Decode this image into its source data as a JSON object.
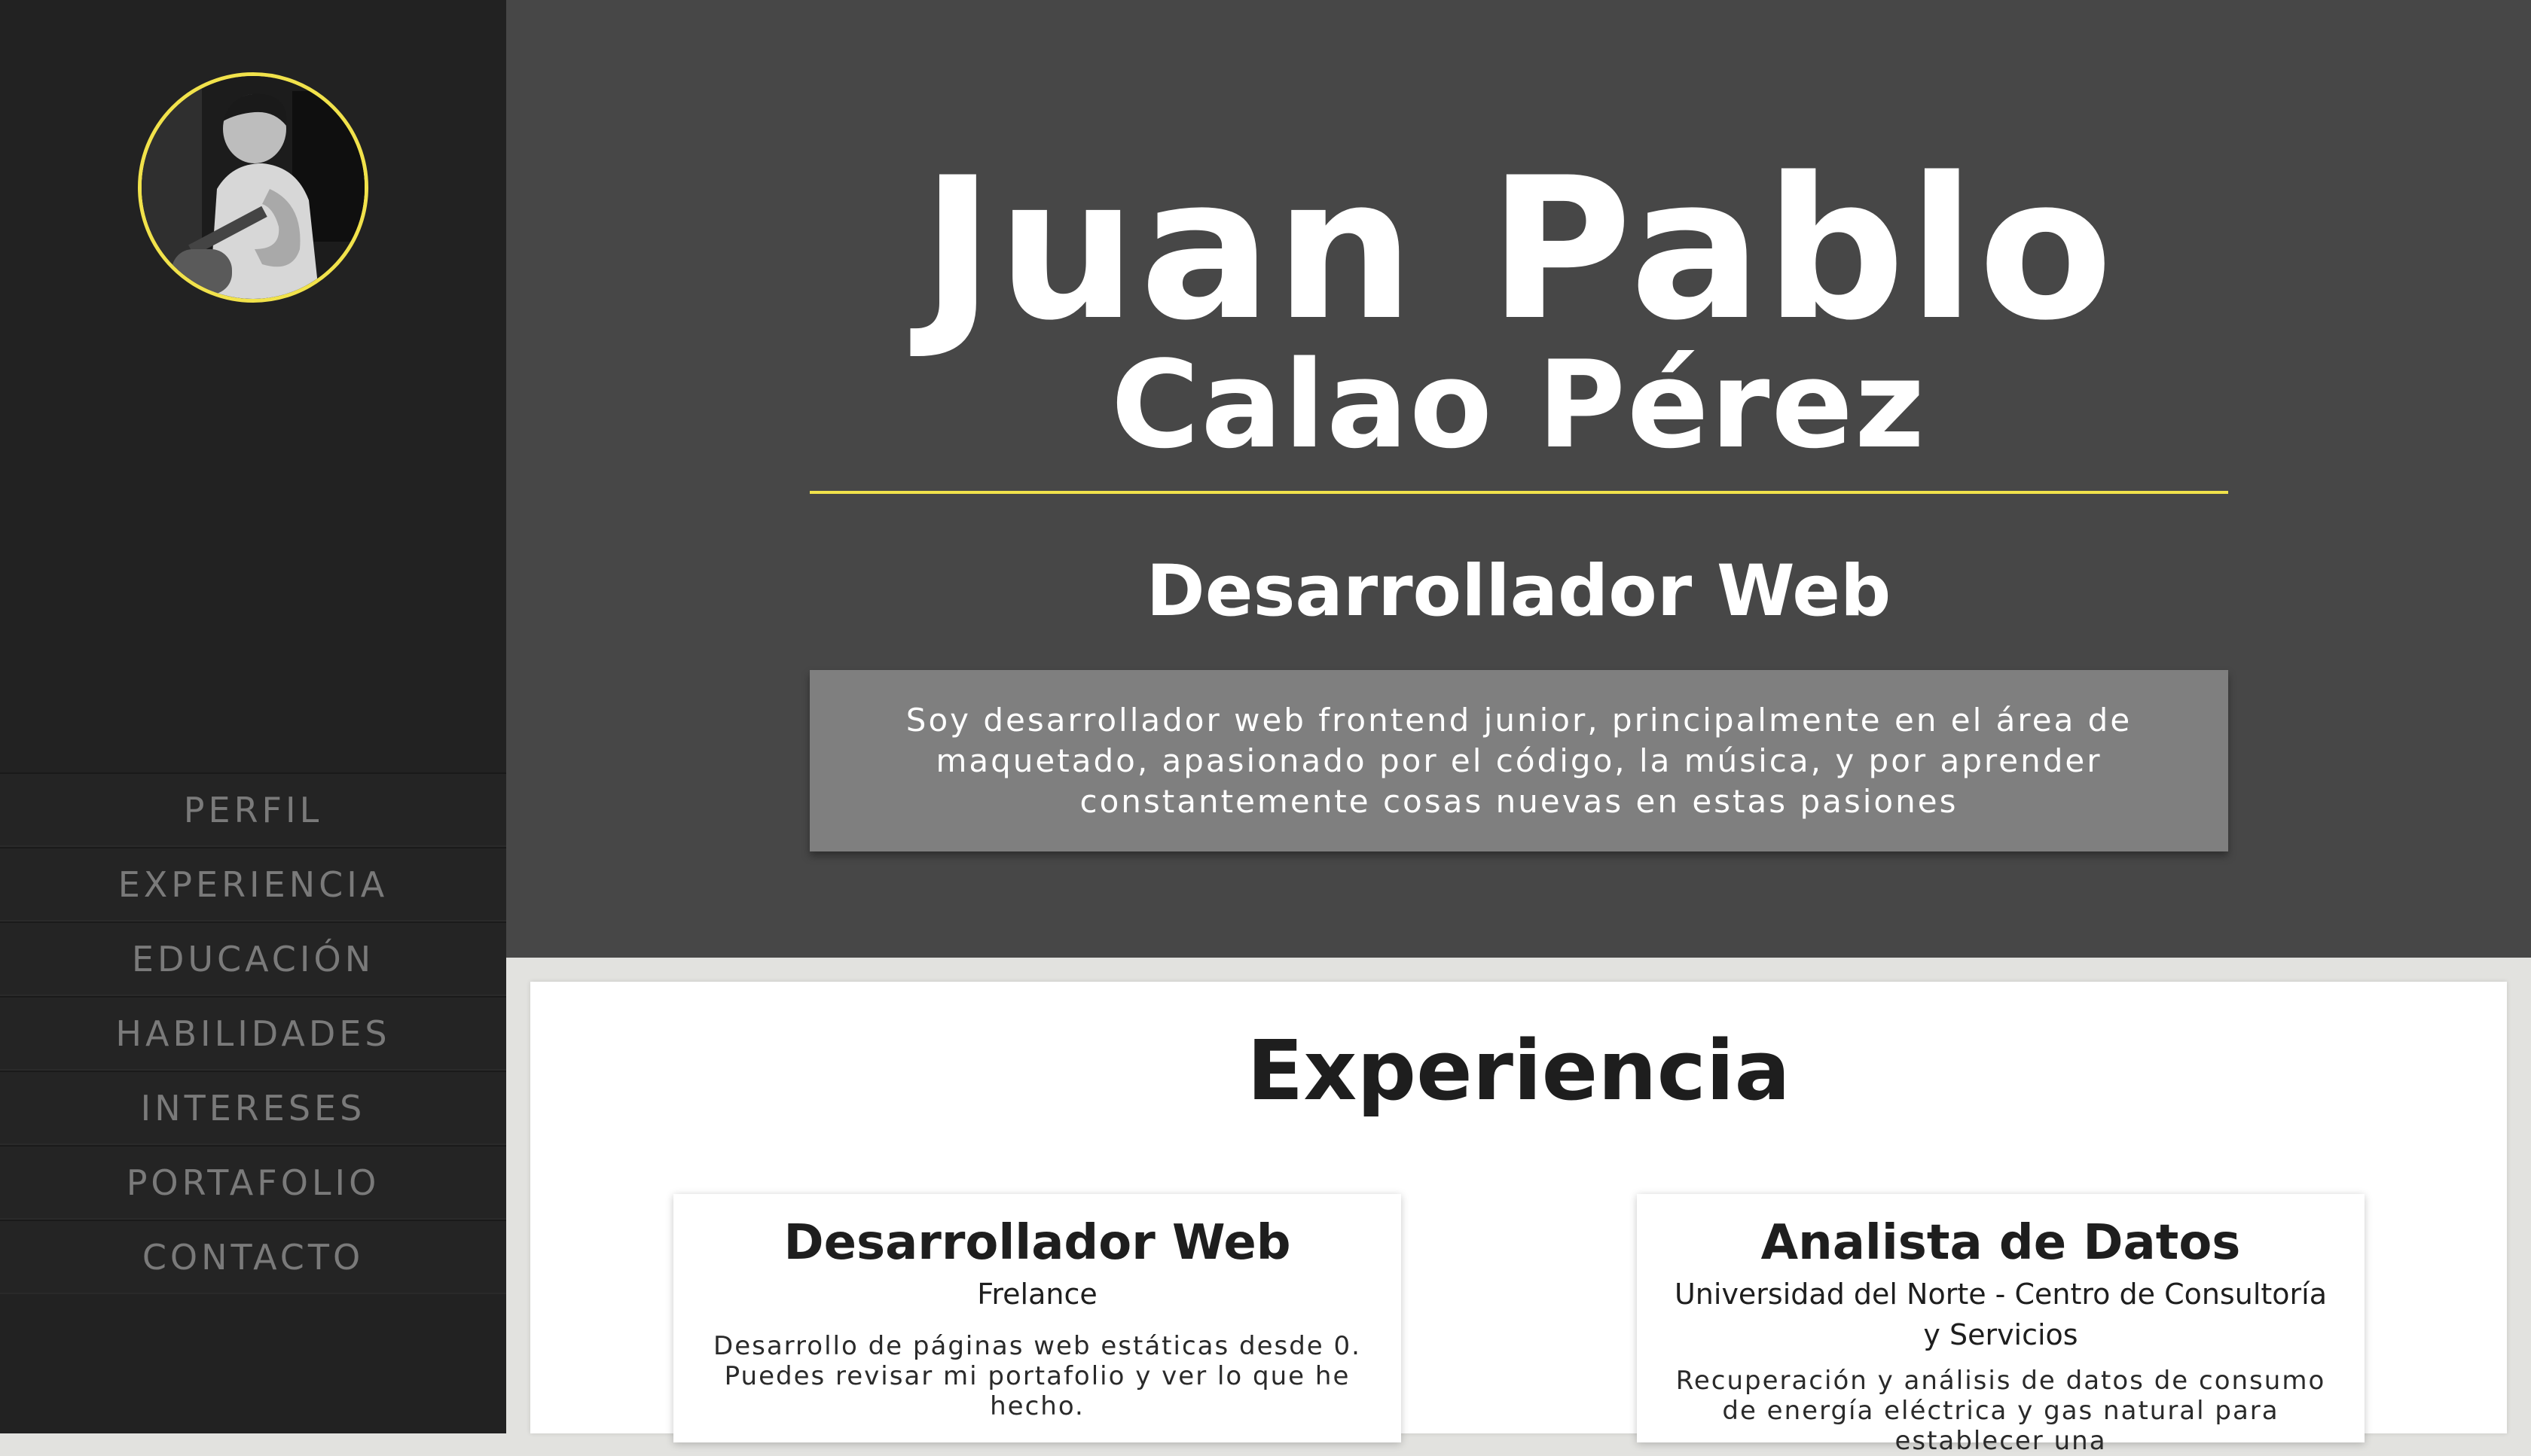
{
  "sidebar": {
    "avatar_alt": "",
    "nav": [
      {
        "label": "PERFIL"
      },
      {
        "label": "EXPERIENCIA"
      },
      {
        "label": "EDUCACIÓN"
      },
      {
        "label": "HABILIDADES"
      },
      {
        "label": "INTERESES"
      },
      {
        "label": "PORTAFOLIO"
      },
      {
        "label": "CONTACTO"
      }
    ]
  },
  "hero": {
    "first_name": "Juan Pablo",
    "last_name": "Calao Pérez",
    "role": "Desarrollador Web",
    "bio": "Soy desarrollador web frontend junior, principalmente en el área de maquetado, apasionado por el código, la música, y por aprender constantemente cosas nuevas en estas pasiones"
  },
  "experience": {
    "title": "Experiencia",
    "cards": [
      {
        "title": "Desarrollador Web",
        "company": "Frelance",
        "description": "Desarrollo de páginas web estáticas desde 0. Puedes revisar mi portafolio y ver lo que he hecho."
      },
      {
        "title": "Analista de Datos",
        "company": "Universidad del Norte - Centro de Consultoría y Servicios",
        "description": "Recuperación y análisis de datos de consumo de energía eléctrica y gas natural para establecer una"
      }
    ]
  },
  "colors": {
    "accent": "#f1e24b",
    "sidebar_bg": "#222222",
    "hero_bg": "#474747",
    "bio_bg": "#7f7f7f",
    "nav_text": "#7a7a7a"
  }
}
